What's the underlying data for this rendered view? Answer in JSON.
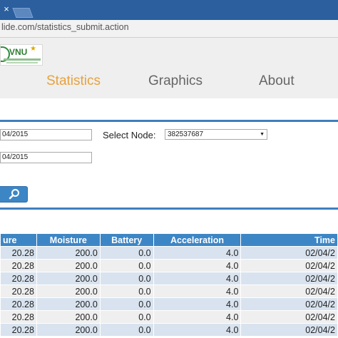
{
  "browser": {
    "tab_close_glyph": "×",
    "url": "lide.com/statistics_submit.action"
  },
  "header": {
    "logo_text": "VNU",
    "nav": [
      {
        "label": "Statistics",
        "active": true
      },
      {
        "label": "Graphics",
        "active": false
      },
      {
        "label": "About",
        "active": false
      }
    ]
  },
  "form": {
    "from_date": "04/2015",
    "to_date": "04/2015",
    "node_label": "Select Node:",
    "node_value": "382537687",
    "search_icon": "search-icon"
  },
  "table": {
    "headers": [
      "ure",
      "Moisture",
      "Battery",
      "Acceleration",
      "Time"
    ],
    "rows": [
      [
        "20.28",
        "200.0",
        "0.0",
        "4.0",
        "02/04/2"
      ],
      [
        "20.28",
        "200.0",
        "0.0",
        "4.0",
        "02/04/2"
      ],
      [
        "20.28",
        "200.0",
        "0.0",
        "4.0",
        "02/04/2"
      ],
      [
        "20.28",
        "200.0",
        "0.0",
        "4.0",
        "02/04/2"
      ],
      [
        "20.28",
        "200.0",
        "0.0",
        "4.0",
        "02/04/2"
      ],
      [
        "20.28",
        "200.0",
        "0.0",
        "4.0",
        "02/04/2"
      ],
      [
        "20.28",
        "200.0",
        "0.0",
        "4.0",
        "02/04/2"
      ]
    ]
  },
  "colors": {
    "accent": "#3d86c6",
    "nav_active": "#e8a23d",
    "tab_bar": "#2b5f9e"
  }
}
